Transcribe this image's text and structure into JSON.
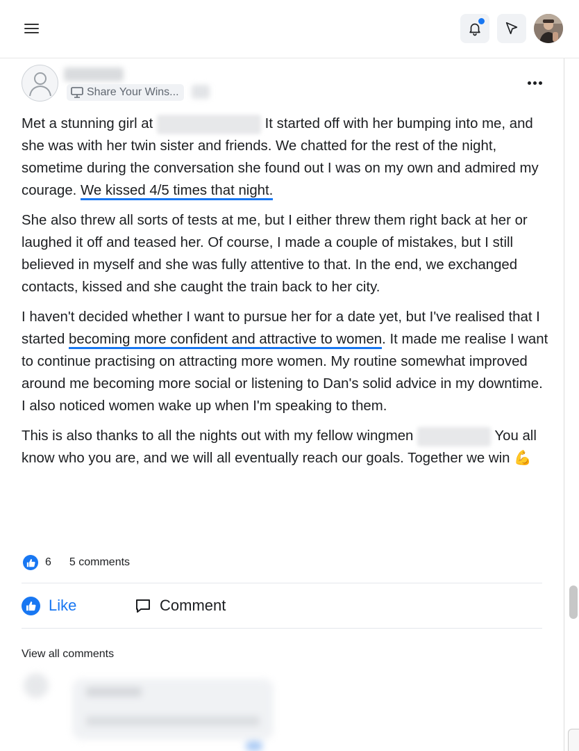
{
  "header": {
    "menu_icon": "hamburger-menu-icon",
    "notification_icon": "bell-icon",
    "notification_dot_color": "#1877f2",
    "send_icon": "send-arrow-icon",
    "avatar": "profile-avatar"
  },
  "post": {
    "group_label": "Share Your Wins...",
    "group_icon": "monitor-icon",
    "more_icon": "ellipsis-icon",
    "paragraphs": {
      "p1_a": "Met a stunning girl at",
      "p1_b": "It started off with her bumping into me, and she was with her twin sister and friends. We chatted for the rest of the night, sometime during the conversation she found out I was on my own and admired my courage.",
      "p1_highlight": "We kissed 4/5 times that night",
      "p1_end": ".",
      "p2": "She also threw all sorts of tests at me, but I either threw them right back at her or laughed it off and teased her. Of course, I made a couple of mistakes, but I still believed in myself and she was fully attentive to that. In the end, we exchanged contacts, kissed and she caught the train back to her city.",
      "p3_a": "I haven't decided whether I want to pursue her for a date yet, but I've realised that I started",
      "p3_highlight": "becoming more confident and attractive to women",
      "p3_b": ". It made me realise I want to continue practising on attracting more women. My routine somewhat improved around me becoming more social or listening to Dan's solid advice in my downtime. I also noticed women wake up when I'm speaking to them.",
      "p4_a": "This is also thanks to all the nights out with my fellow wingmen",
      "p4_b": "You all know who you are, and we will all eventually reach our goals. Together we win",
      "p4_emoji": "💪"
    },
    "highlight_color": "#1877f2"
  },
  "reactions": {
    "like_count": "6",
    "comments_label": "5 comments",
    "like_icon": "thumbs-up-icon"
  },
  "actions": {
    "like_label": "Like",
    "comment_label": "Comment",
    "comment_icon": "speech-bubble-icon"
  },
  "comments": {
    "view_all_label": "View all comments"
  },
  "colors": {
    "accent": "#1877f2",
    "text": "#1c1e21",
    "muted": "#606770"
  }
}
